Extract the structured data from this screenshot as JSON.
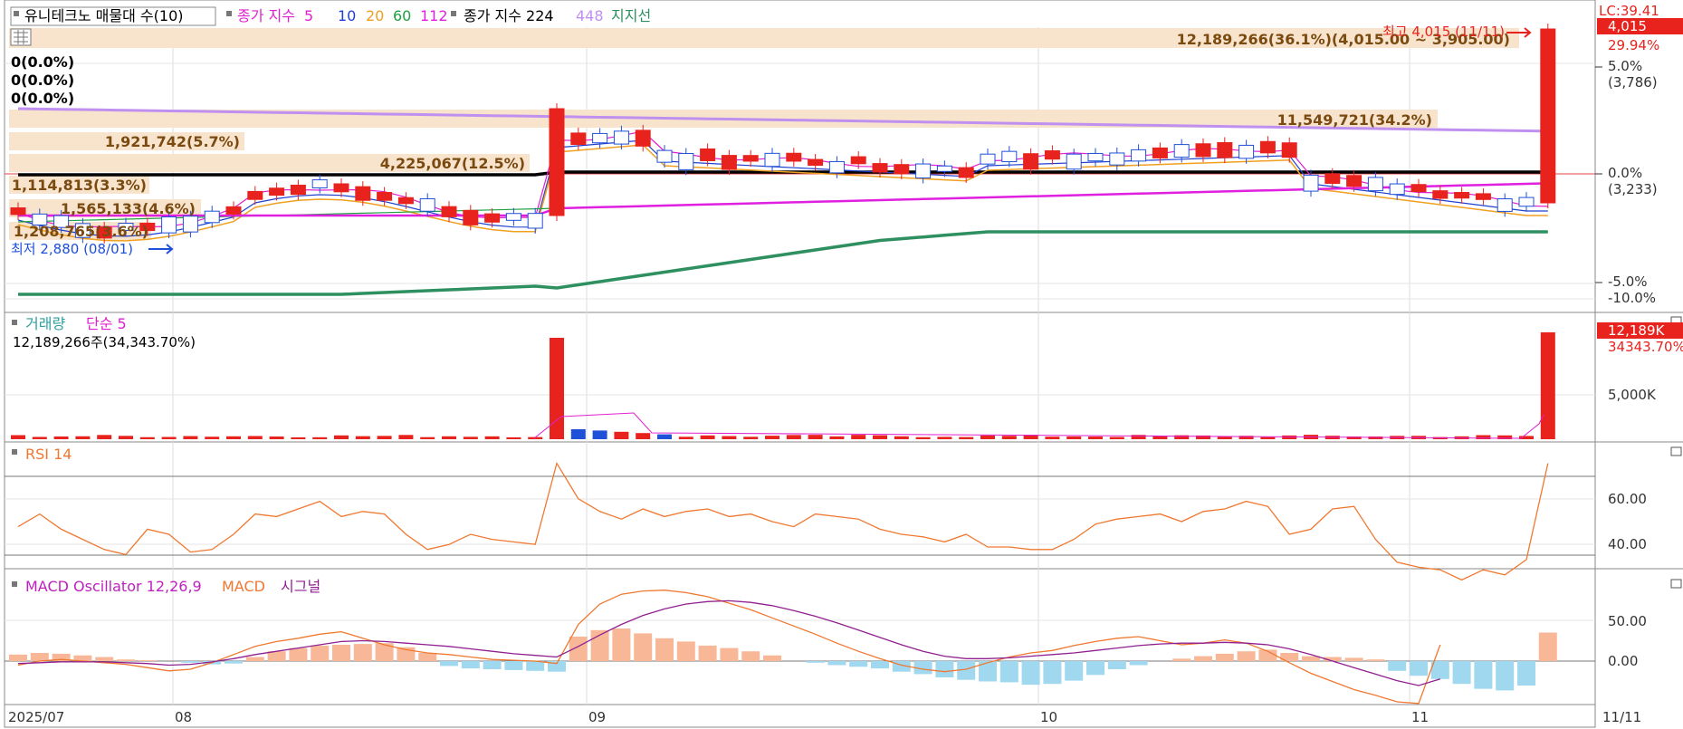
{
  "title_bar": {
    "stock_label": "유니테크노 매물대 수(10)",
    "ma_label": "종가 지수",
    "ma_periods": [
      "5",
      "10",
      "20",
      "60",
      "112"
    ],
    "ma_long_label": "종가 지수 224",
    "ma_long_extra": "448",
    "support_label": "지지선"
  },
  "right_axis": {
    "lc": "LC:39.41",
    "price_badge": "4,015",
    "pct_top": "29.94%",
    "ticks": [
      {
        "text": "5.0%"
      },
      {
        "text": "(3,786)"
      },
      {
        "text": "0.0%"
      },
      {
        "text": "(3,233)"
      },
      {
        "text": "-5.0%"
      },
      {
        "text": "-10.0%"
      }
    ]
  },
  "price_panel": {
    "high_note": "최고 4,015 (11/11)",
    "low_note": "최저 2,880 (08/01)",
    "zero_labels": [
      "0(0.0%)",
      "0(0.0%)",
      "0(0.0%)"
    ],
    "volume_profile": [
      {
        "label": "12,189,266(36.1%)(4,015.00 ~ 3,905.00)"
      },
      {
        "label": "11,549,721(34.2%)"
      },
      {
        "label": "1,921,742(5.7%)"
      },
      {
        "label": "4,225,067(12.5%)"
      },
      {
        "label": "1,114,813(3.3%)"
      },
      {
        "label": "1,565,133(4.6%)"
      },
      {
        "label": "1,208,765(3.6%)"
      }
    ]
  },
  "volume_panel": {
    "label": "거래량",
    "ma_label": "단순 5",
    "info": "12,189,266주(34,343.70%)",
    "badge": "12,189K",
    "badge2": "34343.70%",
    "tick": "5,000K"
  },
  "rsi_panel": {
    "label": "RSI 14",
    "ticks": [
      "60.00",
      "40.00"
    ]
  },
  "macd_panel": {
    "label": "MACD Oscillator 12,26,9",
    "macd_label": "MACD",
    "signal_label": "시그널",
    "ticks": [
      "50.00",
      "0.00"
    ]
  },
  "x_axis": {
    "labels": [
      "2025/07",
      "08",
      "09",
      "10",
      "11"
    ],
    "right_label": "11/11"
  },
  "colors": {
    "up": "#e8231d",
    "down": "#1e50d8",
    "ma5": "#e020d0",
    "ma10": "#2040d0",
    "ma20": "#f0a020",
    "ma60": "#20a040",
    "ma112": "#e020e0",
    "ma224": "#000000",
    "ma448": "#c090f0",
    "support": "#2e9060",
    "rsi": "#f07830",
    "macd": "#f07830",
    "signal": "#902090",
    "osc_pos": "#f8b898",
    "osc_neg": "#a0d8f0",
    "profile": "#f8e4cc",
    "profile_text": "#7a4a10"
  },
  "chart_data": [
    {
      "type": "candlestick",
      "panel": "price",
      "x_range": [
        "2025/07",
        "11/11"
      ],
      "close_last": 4015,
      "high": {
        "value": 4015,
        "date": "11/11"
      },
      "low": {
        "value": 2880,
        "date": "08/01"
      },
      "reference_prices": [
        3786,
        3233
      ],
      "volume_profile_pct": [
        36.1,
        34.2,
        5.7,
        12.5,
        3.3,
        4.6,
        3.6
      ]
    },
    {
      "type": "bar",
      "panel": "volume",
      "last_volume": 12189266,
      "last_change_pct": 34343.7
    },
    {
      "type": "line",
      "panel": "rsi",
      "name": "RSI 14",
      "ylim": [
        30,
        80
      ],
      "values": [
        53,
        58,
        52,
        48,
        44,
        42,
        52,
        50,
        43,
        44,
        50,
        58,
        57,
        60,
        63,
        57,
        59,
        58,
        50,
        44,
        46,
        50,
        48,
        47,
        46,
        78,
        64,
        59,
        56,
        60,
        57,
        59,
        60,
        57,
        58,
        55,
        53,
        58,
        57,
        56,
        52,
        50,
        49,
        47,
        50,
        45,
        45,
        44,
        44,
        48,
        54,
        56,
        57,
        58,
        55,
        59,
        60,
        63,
        61,
        50,
        52,
        60,
        61,
        48,
        39,
        37,
        36,
        32,
        36,
        34,
        40,
        78
      ]
    },
    {
      "type": "bar",
      "panel": "macd",
      "name": "MACD Oscillator 12,26,9",
      "ylim": [
        -55,
        100
      ],
      "values": [
        8,
        10,
        9,
        7,
        5,
        2,
        1,
        0,
        -2,
        -4,
        -3,
        5,
        12,
        16,
        19,
        20,
        21,
        22,
        17,
        10,
        -6,
        -9,
        -10,
        -11,
        -12,
        -13,
        30,
        38,
        40,
        34,
        28,
        24,
        19,
        16,
        12,
        7,
        0,
        -2,
        -5,
        -7,
        -9,
        -13,
        -16,
        -20,
        -23,
        -25,
        -26,
        -29,
        -28,
        -24,
        -17,
        -10,
        -5,
        0,
        3,
        6,
        9,
        12,
        14,
        10,
        6,
        5,
        4,
        2,
        -12,
        -18,
        -22,
        -28,
        -34,
        -36,
        -30,
        35
      ]
    },
    {
      "type": "line",
      "panel": "macd",
      "name": "MACD",
      "values": [
        -5,
        0,
        2,
        0,
        -2,
        -4,
        -8,
        -12,
        -10,
        -2,
        8,
        18,
        24,
        28,
        33,
        36,
        28,
        20,
        14,
        10,
        8,
        5,
        2,
        1,
        0,
        -3,
        45,
        70,
        82,
        86,
        87,
        84,
        79,
        71,
        63,
        53,
        43,
        33,
        22,
        12,
        3,
        -5,
        -10,
        -13,
        -10,
        -2,
        5,
        10,
        13,
        19,
        24,
        28,
        30,
        25,
        20,
        22,
        26,
        22,
        12,
        -2,
        -15,
        -25,
        -35,
        -42,
        -50,
        -52,
        20
      ]
    },
    {
      "type": "line",
      "panel": "macd",
      "name": "시그널",
      "values": [
        -3,
        -2,
        -1,
        -1,
        -1,
        -2,
        -3,
        -5,
        -4,
        -1,
        3,
        8,
        12,
        16,
        20,
        24,
        25,
        24,
        22,
        20,
        18,
        15,
        12,
        9,
        7,
        5,
        18,
        32,
        45,
        56,
        64,
        70,
        73,
        74,
        72,
        68,
        62,
        55,
        47,
        38,
        29,
        20,
        12,
        6,
        3,
        3,
        4,
        6,
        8,
        10,
        13,
        16,
        19,
        21,
        22,
        22,
        23,
        22,
        20,
        15,
        8,
        0,
        -8,
        -16,
        -24,
        -30,
        -22
      ]
    }
  ]
}
